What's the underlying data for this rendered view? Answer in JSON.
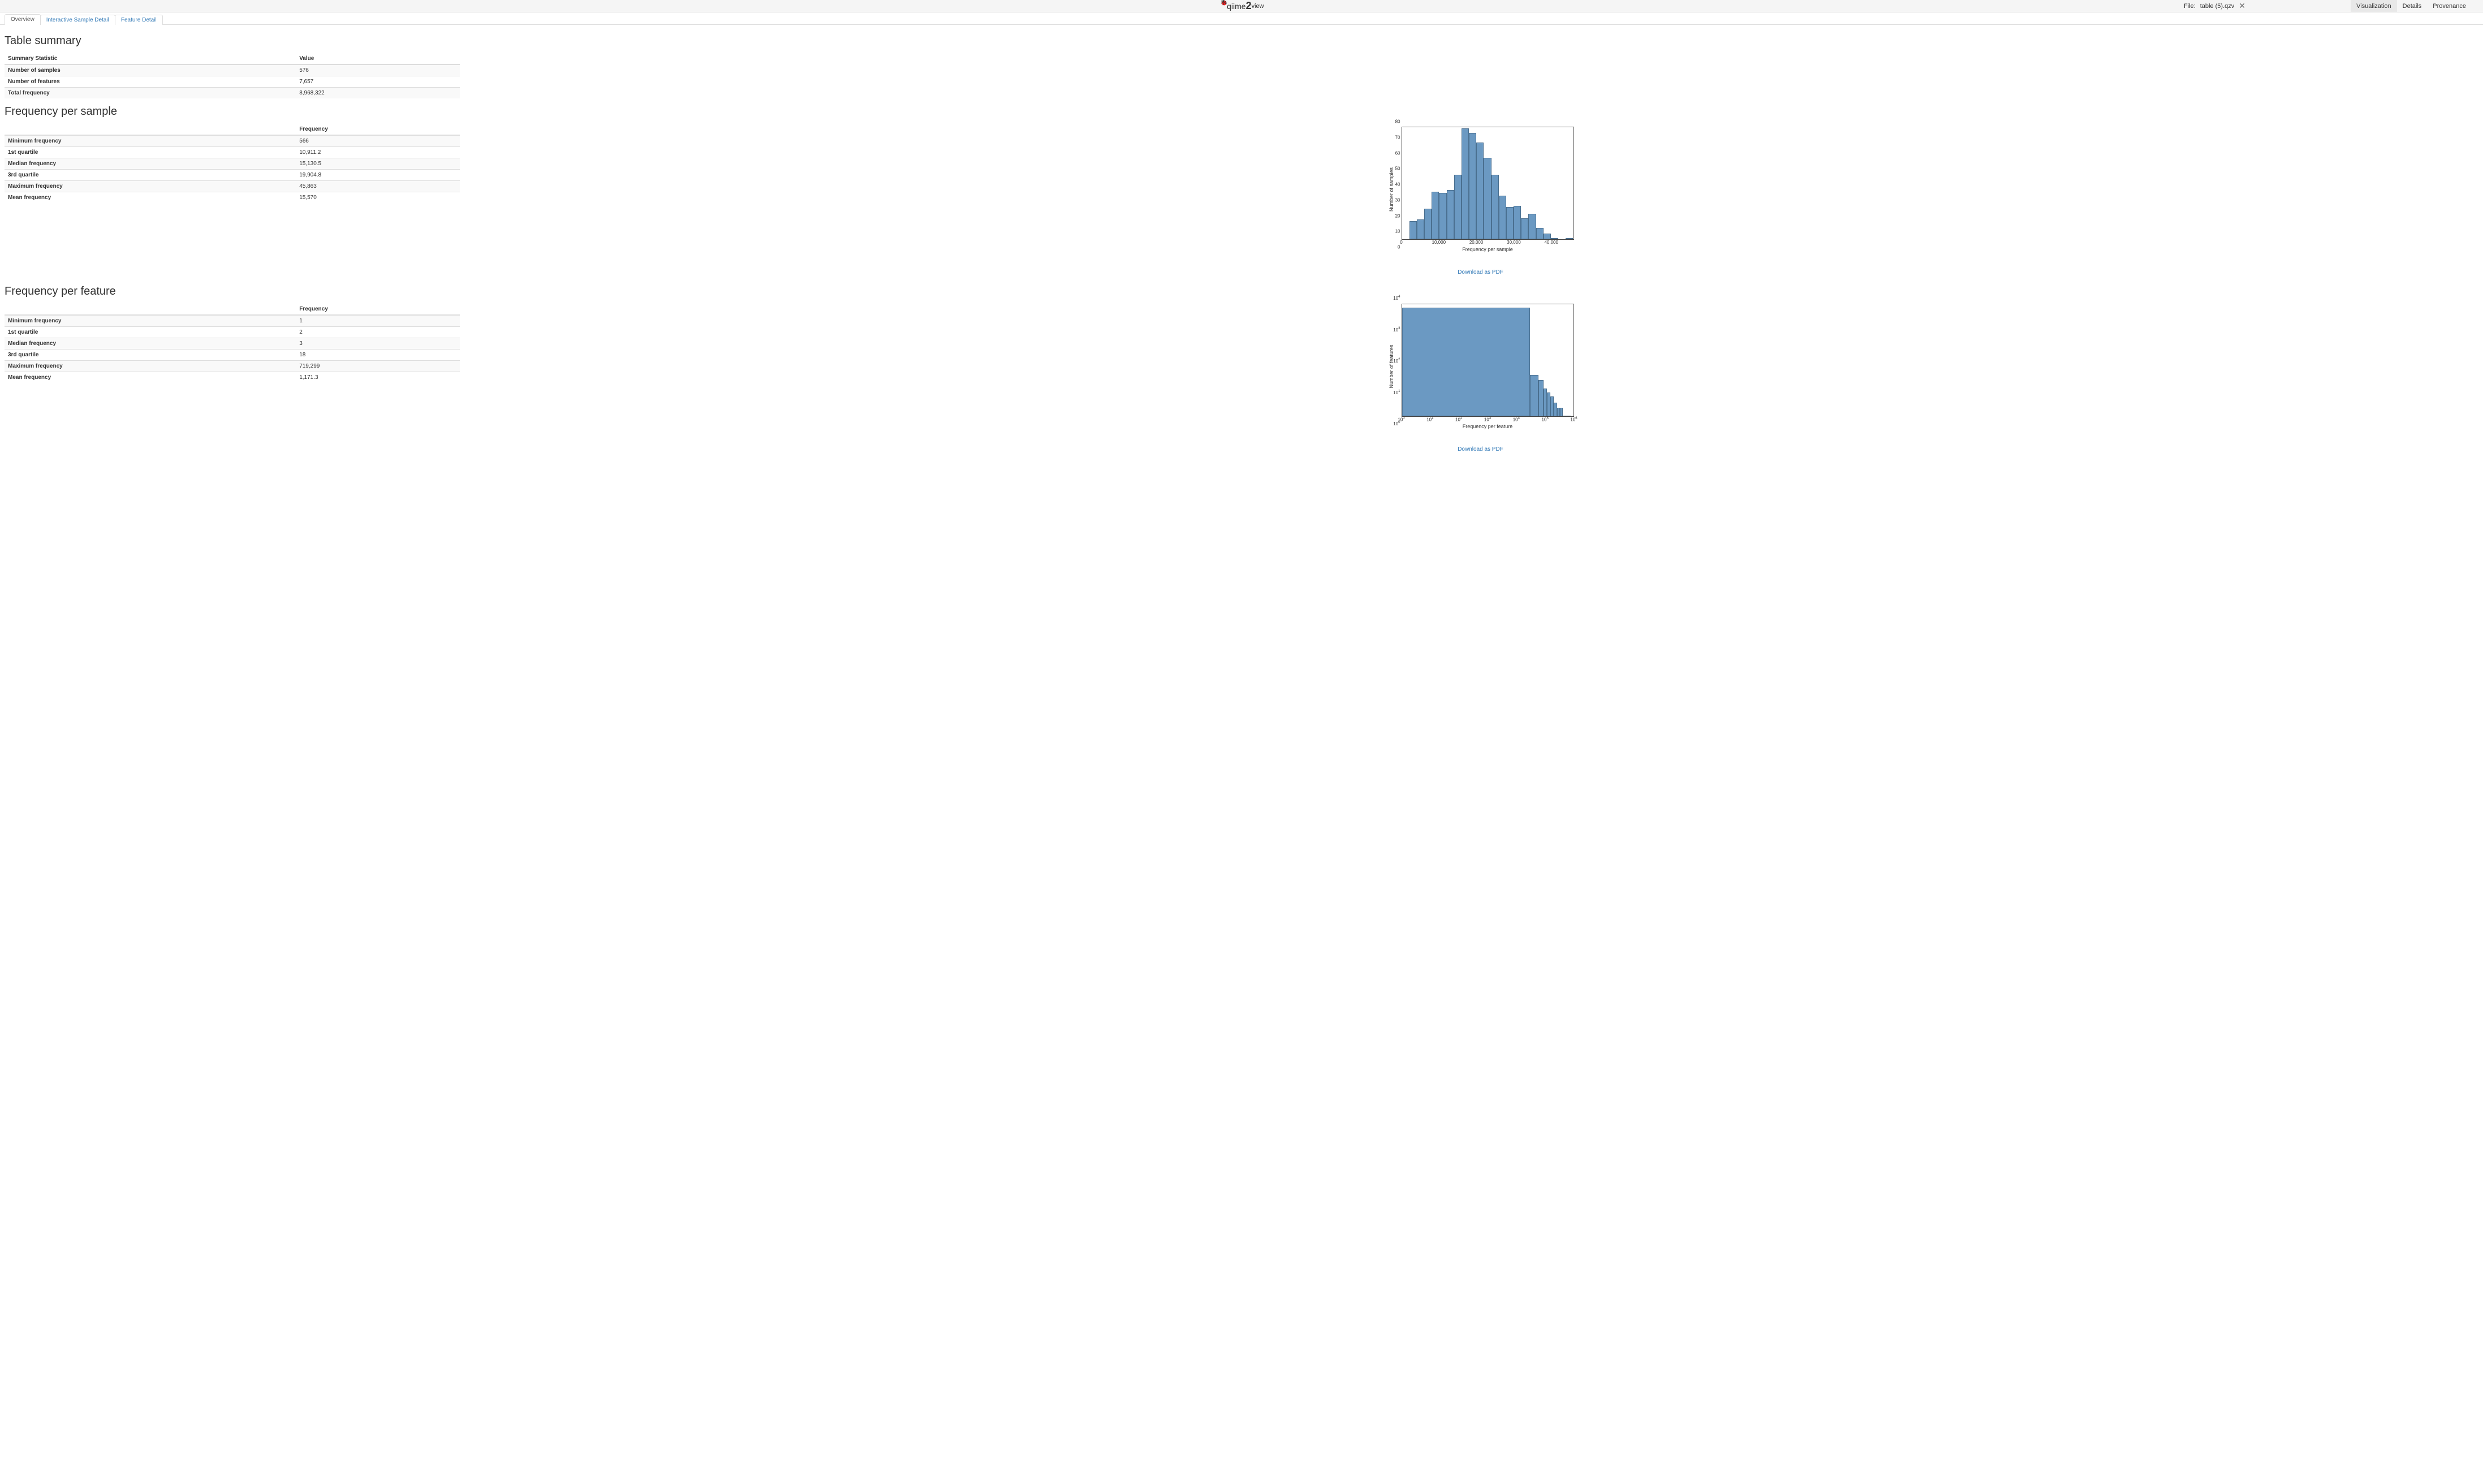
{
  "header": {
    "logo_q": "q",
    "logo_mid": "iime",
    "logo_2": "2",
    "logo_view": "view",
    "file_prefix": "File:",
    "file_name": "table (5).qzv",
    "tabs": [
      {
        "label": "Visualization",
        "active": true
      },
      {
        "label": "Details",
        "active": false
      },
      {
        "label": "Provenance",
        "active": false
      }
    ]
  },
  "subtabs": [
    {
      "label": "Overview",
      "active": true
    },
    {
      "label": "Interactive Sample Detail",
      "active": false
    },
    {
      "label": "Feature Detail",
      "active": false
    }
  ],
  "summary": {
    "title": "Table summary",
    "col_stat": "Summary Statistic",
    "col_value": "Value",
    "rows": [
      {
        "label": "Number of samples",
        "value": "576"
      },
      {
        "label": "Number of features",
        "value": "7,657"
      },
      {
        "label": "Total frequency",
        "value": "8,968,322"
      }
    ]
  },
  "freq_sample": {
    "title": "Frequency per sample",
    "col_freq": "Frequency",
    "rows": [
      {
        "label": "Minimum frequency",
        "value": "566"
      },
      {
        "label": "1st quartile",
        "value": "10,911.2"
      },
      {
        "label": "Median frequency",
        "value": "15,130.5"
      },
      {
        "label": "3rd quartile",
        "value": "19,904.8"
      },
      {
        "label": "Maximum frequency",
        "value": "45,863"
      },
      {
        "label": "Mean frequency",
        "value": "15,570"
      }
    ]
  },
  "freq_feature": {
    "title": "Frequency per feature",
    "col_freq": "Frequency",
    "rows": [
      {
        "label": "Minimum frequency",
        "value": "1"
      },
      {
        "label": "1st quartile",
        "value": "2"
      },
      {
        "label": "Median frequency",
        "value": "3"
      },
      {
        "label": "3rd quartile",
        "value": "18"
      },
      {
        "label": "Maximum frequency",
        "value": "719,299"
      },
      {
        "label": "Mean frequency",
        "value": "1,171.3"
      }
    ]
  },
  "pdf_link": "Download as PDF",
  "chart_data": [
    {
      "type": "bar",
      "title": "",
      "xlabel": "Frequency per sample",
      "ylabel": "Number of samples",
      "x_ticks": [
        "0",
        "10,000",
        "20,000",
        "30,000",
        "40,000"
      ],
      "y_ticks": [
        "0",
        "10",
        "20",
        "30",
        "40",
        "50",
        "60",
        "70",
        "80"
      ],
      "ylim": [
        0,
        80
      ],
      "xlim": [
        0,
        46000
      ],
      "bin_width": 2000,
      "bins_start": 0,
      "values": [
        0,
        13,
        14,
        22,
        34,
        33,
        35,
        46,
        79,
        76,
        69,
        58,
        46,
        31,
        23,
        24,
        15,
        18,
        8,
        4,
        1,
        0,
        1
      ]
    },
    {
      "type": "bar",
      "title": "",
      "xlabel": "Frequency per feature",
      "ylabel": "Number of features",
      "xscale": "log",
      "yscale": "log",
      "x_ticks": [
        "10^0",
        "10^1",
        "10^2",
        "10^3",
        "10^4",
        "10^5",
        "10^6"
      ],
      "y_ticks": [
        "10^0",
        "10^1",
        "10^2",
        "10^3",
        "10^4"
      ],
      "bin_edges_approx": [
        1,
        30000,
        60000,
        90000,
        120000,
        160000,
        210000,
        270000,
        340000,
        430000,
        540000,
        670000,
        720000
      ],
      "values_approx": [
        7500,
        30,
        20,
        10,
        7,
        5,
        3,
        2,
        2,
        1,
        1,
        1,
        1
      ]
    }
  ]
}
